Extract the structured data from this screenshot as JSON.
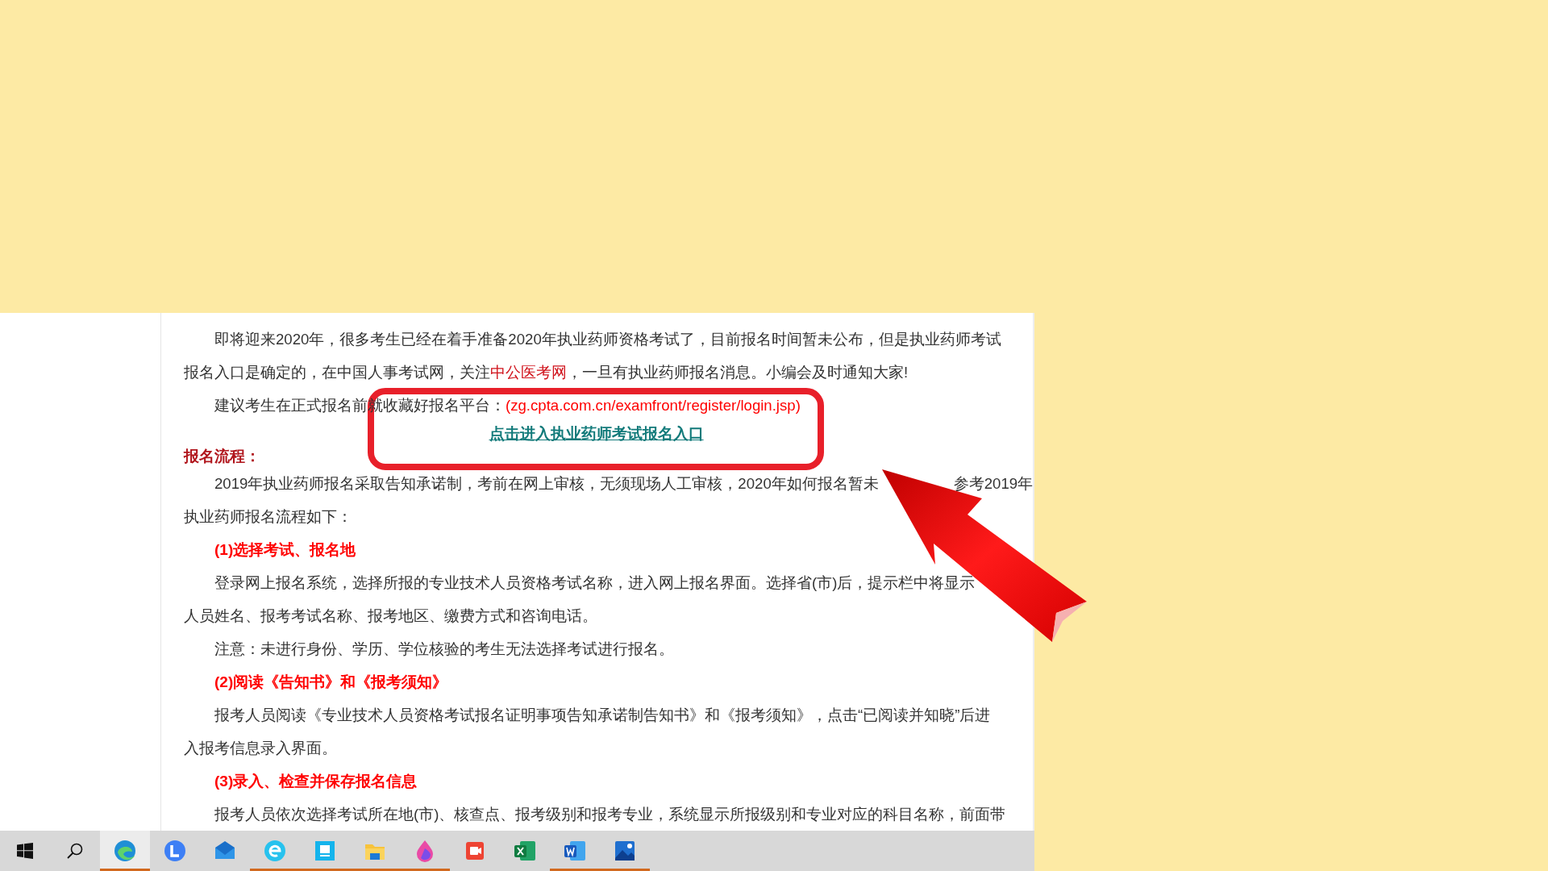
{
  "article": {
    "rows": [
      {
        "kind": "para_start",
        "segments": [
          {
            "kind": "plain",
            "text": "即将迎来2020年，很多考生已经在着手准备2020年执业药师资格考试了，目前报名时间暂未公布，但是执业药师考试"
          }
        ]
      },
      {
        "kind": "para_cont",
        "segments": [
          {
            "kind": "plain",
            "text": "报名入口是确定的，在中国人事考试网，关注"
          },
          {
            "kind": "link",
            "text": "中公医考网"
          },
          {
            "kind": "plain",
            "text": "，一旦有执业药师报名消息。小编会及时通知大家!"
          }
        ]
      },
      {
        "kind": "para_start",
        "segments": [
          {
            "kind": "plain",
            "text": "建议考生在正式报名前就收藏好报名平台："
          },
          {
            "kind": "url",
            "text": "(zg.cpta.com.cn/examfront/register/login.jsp)"
          }
        ]
      },
      {
        "kind": "button_link",
        "text": "点击进入执业药师考试报名入口"
      },
      {
        "kind": "heading",
        "text": "报名流程："
      },
      {
        "kind": "para_start",
        "segments": [
          {
            "kind": "plain",
            "text": "2019年执业药师报名采取告知承诺制，考前在网上审核，无须现场人工审核，2020年如何报名暂未"
          },
          {
            "kind": "gap",
            "text": "参考2019年"
          }
        ]
      },
      {
        "kind": "para_cont",
        "segments": [
          {
            "kind": "plain",
            "text": "执业药师报名流程如下："
          }
        ]
      },
      {
        "kind": "subheading",
        "text": "(1)选择考试、报名地"
      },
      {
        "kind": "para_start",
        "segments": [
          {
            "kind": "plain",
            "text": "登录网上报名系统，选择所报的专业技术人员资格考试名称，进入网上报名界面。选择省(市)后，提示栏中将显示"
          }
        ]
      },
      {
        "kind": "para_cont",
        "segments": [
          {
            "kind": "plain",
            "text": "人员姓名、报考考试名称、报考地区、缴费方式和咨询电话。"
          }
        ]
      },
      {
        "kind": "para_start",
        "segments": [
          {
            "kind": "plain",
            "text": "注意：未进行身份、学历、学位核验的考生无法选择考试进行报名。"
          }
        ]
      },
      {
        "kind": "subheading",
        "text": "(2)阅读《告知书》和《报考须知》"
      },
      {
        "kind": "para_start",
        "segments": [
          {
            "kind": "plain",
            "text": "报考人员阅读《专业技术人员资格考试报名证明事项告知承诺制告知书》和《报考须知》，点击“已阅读并知晓”后进"
          }
        ]
      },
      {
        "kind": "para_cont",
        "segments": [
          {
            "kind": "plain",
            "text": "入报考信息录入界面。"
          }
        ]
      },
      {
        "kind": "subheading",
        "text": "(3)录入、检查并保存报名信息"
      },
      {
        "kind": "para_start",
        "segments": [
          {
            "kind": "plain",
            "text": "报考人员依次选择考试所在地(市)、核查点、报考级别和报考专业，系统显示所报级别和专业对应的科目名称，前面带"
          }
        ]
      }
    ]
  },
  "taskbar": {
    "apps": [
      {
        "running": true,
        "selected": true
      },
      {
        "running": false,
        "selected": false
      },
      {
        "running": false,
        "selected": false
      },
      {
        "running": true,
        "selected": false
      },
      {
        "running": true,
        "selected": false
      },
      {
        "running": true,
        "selected": false
      },
      {
        "running": true,
        "selected": false
      },
      {
        "running": false,
        "selected": false
      },
      {
        "running": false,
        "selected": false
      },
      {
        "running": true,
        "selected": false
      },
      {
        "running": true,
        "selected": false
      }
    ]
  }
}
